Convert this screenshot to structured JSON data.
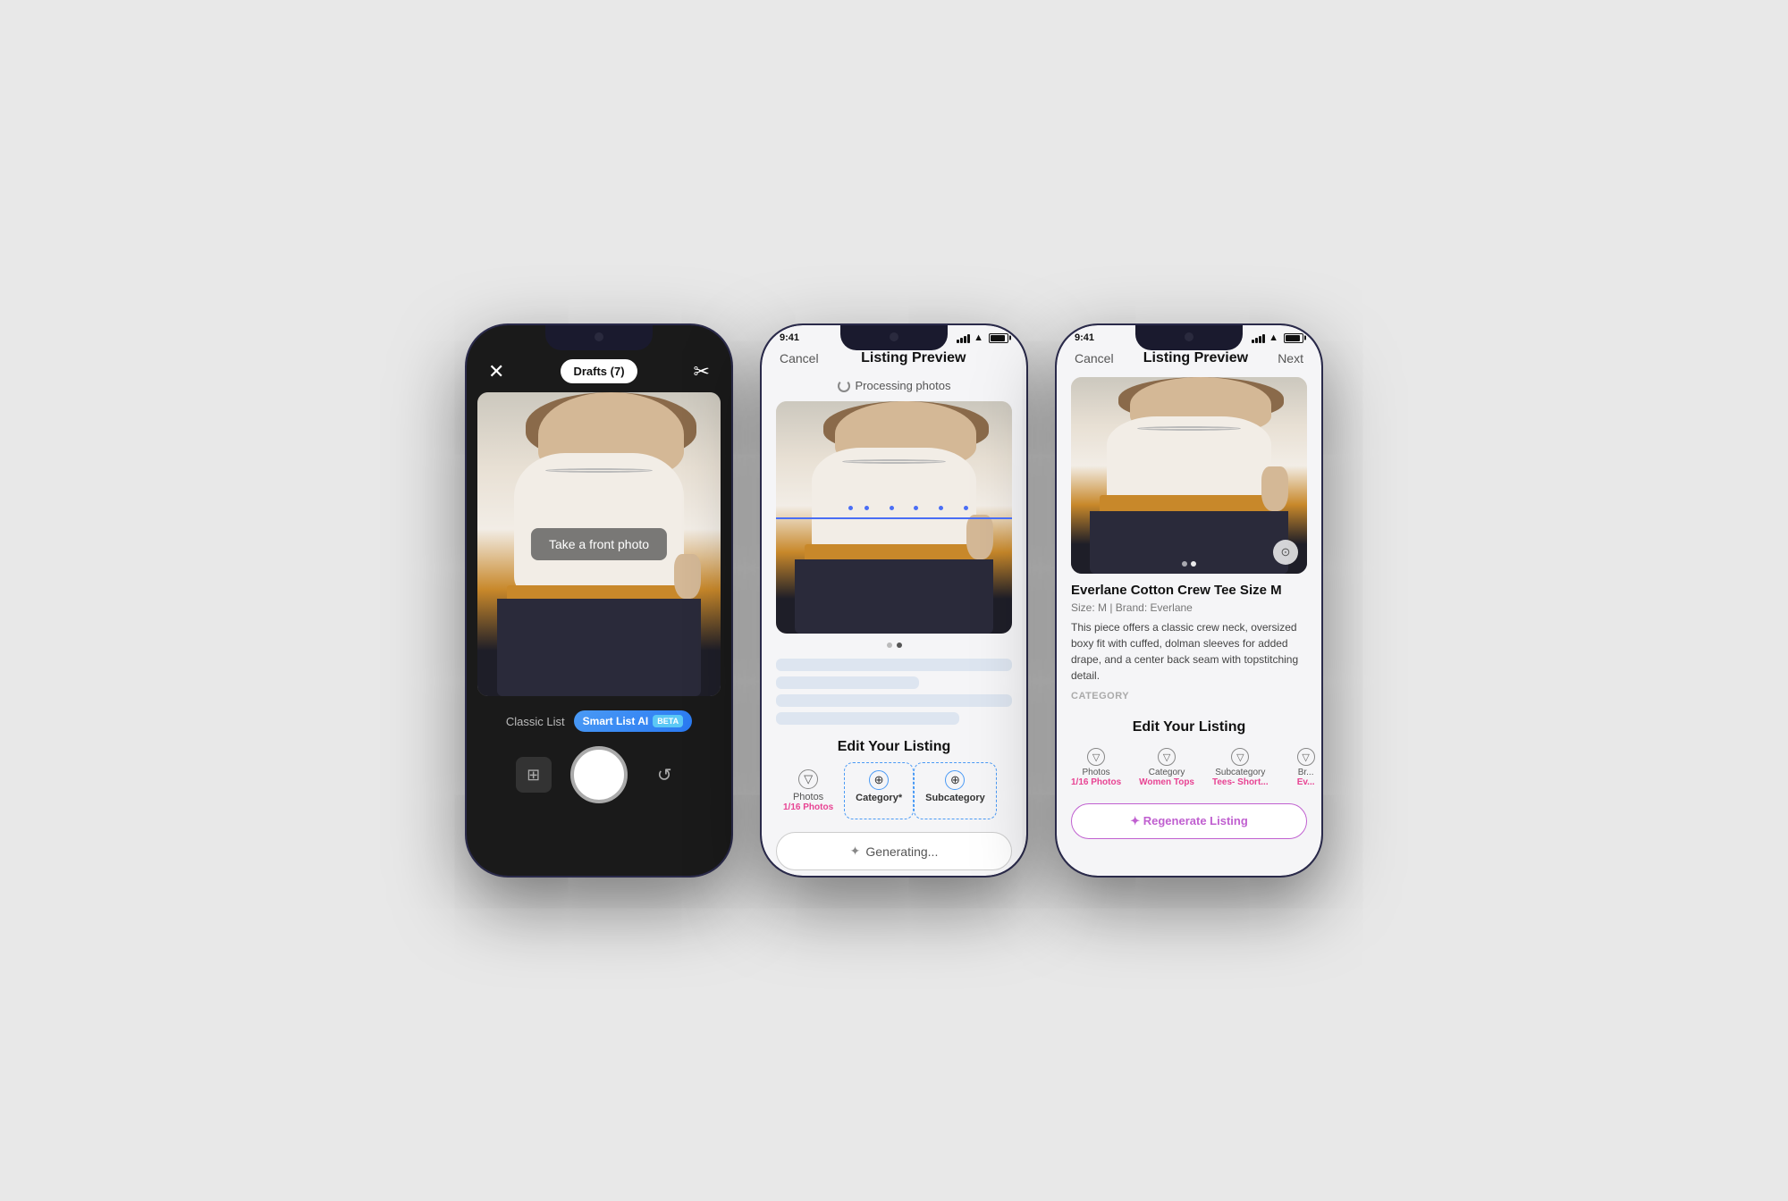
{
  "phone1": {
    "header": {
      "close_label": "✕",
      "drafts_label": "Drafts (7)",
      "scissors_label": "✂"
    },
    "camera": {
      "overlay_text": "Take a front photo"
    },
    "listing_toggle": {
      "classic_label": "Classic List",
      "smart_label": "Smart List AI",
      "beta_label": "BETA"
    },
    "controls": {
      "gallery_icon": "⊞",
      "flip_icon": "↺"
    }
  },
  "phone2": {
    "status_bar": {
      "time": "9:41",
      "right": "●●●"
    },
    "nav": {
      "cancel": "Cancel",
      "title": "Listing Preview",
      "next": ""
    },
    "processing": {
      "text": "Processing photos"
    },
    "edit_section": {
      "title": "Edit Your Listing",
      "tabs": [
        {
          "label": "Photos",
          "sublabel": "1/16 Photos",
          "has_value": true
        },
        {
          "label": "Category*",
          "sublabel": "",
          "has_value": false,
          "active": true
        },
        {
          "label": "Subcategory",
          "sublabel": "",
          "has_value": false,
          "active": true
        }
      ]
    },
    "generating": {
      "text": "Generating..."
    }
  },
  "phone3": {
    "status_bar": {
      "time": "9:41"
    },
    "nav": {
      "cancel": "Cancel",
      "title": "Listing Preview",
      "next": "Next"
    },
    "listing": {
      "title": "Everlane Cotton Crew Tee Size M",
      "meta": "Size: M  |  Brand: Everlane",
      "description": "This piece offers a classic crew neck, oversized boxy fit with cuffed, dolman sleeves for added drape, and a center back seam with topstitching detail.",
      "category_label": "CATEGORY"
    },
    "edit_section": {
      "title": "Edit Your Listing",
      "tabs": [
        {
          "name": "Photos",
          "value": "1/16 Photos"
        },
        {
          "name": "Category",
          "value": "Women Tops"
        },
        {
          "name": "Subcategory",
          "value": "Tees- Short..."
        },
        {
          "name": "Br...",
          "value": "Ev..."
        }
      ]
    },
    "regenerate": {
      "text": "✦ Regenerate Listing"
    }
  }
}
